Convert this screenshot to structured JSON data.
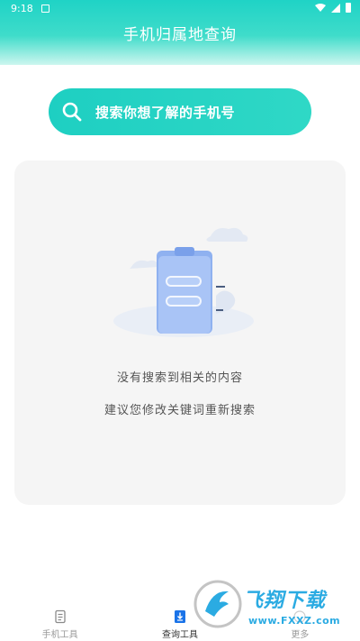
{
  "status": {
    "time": "9:18"
  },
  "header": {
    "title": "手机归属地查询"
  },
  "search": {
    "placeholder": "搜索你想了解的手机号"
  },
  "empty": {
    "line1": "没有搜索到相关的内容",
    "line2": "建议您修改关键词重新搜索"
  },
  "tabs": [
    {
      "label": "手机工具",
      "icon": "document-icon",
      "active": false
    },
    {
      "label": "查询工具",
      "icon": "query-doc-icon",
      "active": true
    },
    {
      "label": "更多",
      "icon": "more-icon",
      "active": false
    }
  ],
  "watermark": {
    "brand": "飞翔下载",
    "url": "www.FXXZ.com"
  },
  "colors": {
    "accent": "#2fd8c6",
    "card": "#f5f5f5",
    "tab_active": "#1a73e8"
  }
}
